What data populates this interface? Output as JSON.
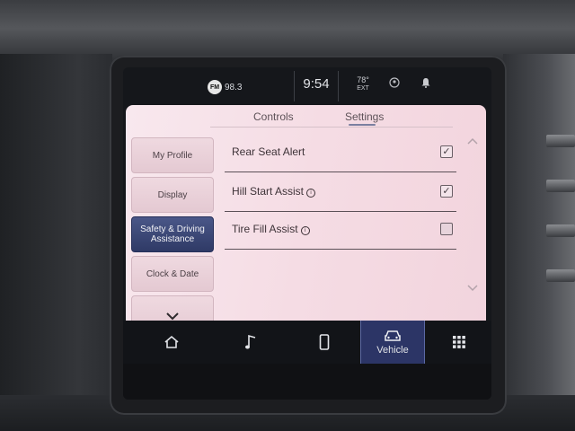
{
  "status": {
    "radio_band": "FM",
    "radio_station": "98.3",
    "time": "9:54",
    "temperature": "78°",
    "temperature_label": "EXT",
    "icons": [
      "fm-icon",
      "driver-icon",
      "notification-bell-icon"
    ]
  },
  "tabs": [
    {
      "label": "Controls",
      "active": false
    },
    {
      "label": "Settings",
      "active": true
    }
  ],
  "sidebar": {
    "items": [
      {
        "label": "My Profile",
        "active": false
      },
      {
        "label": "Display",
        "active": false
      },
      {
        "label": "Safety & Driving Assistance",
        "active": true
      },
      {
        "label": "Clock & Date",
        "active": false
      }
    ],
    "more_icon": "chevron-down-icon"
  },
  "settings": [
    {
      "label": "Rear Seat Alert",
      "checked": true,
      "info": false
    },
    {
      "label": "Hill Start Assist",
      "checked": true,
      "info": true
    },
    {
      "label": "Tire Fill Assist",
      "checked": false,
      "info": true
    }
  ],
  "scroll": {
    "up_icon": "chevron-up-icon",
    "down_icon": "chevron-down-icon"
  },
  "nav": {
    "items": [
      {
        "icon": "home-icon",
        "label": "",
        "active": false
      },
      {
        "icon": "music-icon",
        "label": "",
        "active": false
      },
      {
        "icon": "phone-icon",
        "label": "",
        "active": false
      },
      {
        "icon": "vehicle-icon",
        "label": "Vehicle",
        "active": true
      },
      {
        "icon": "apps-grid-icon",
        "label": "",
        "active": false
      }
    ]
  },
  "colors": {
    "panel_background": "#f5dce4",
    "active_accent": "#2f3a66",
    "nav_background": "#121418"
  }
}
